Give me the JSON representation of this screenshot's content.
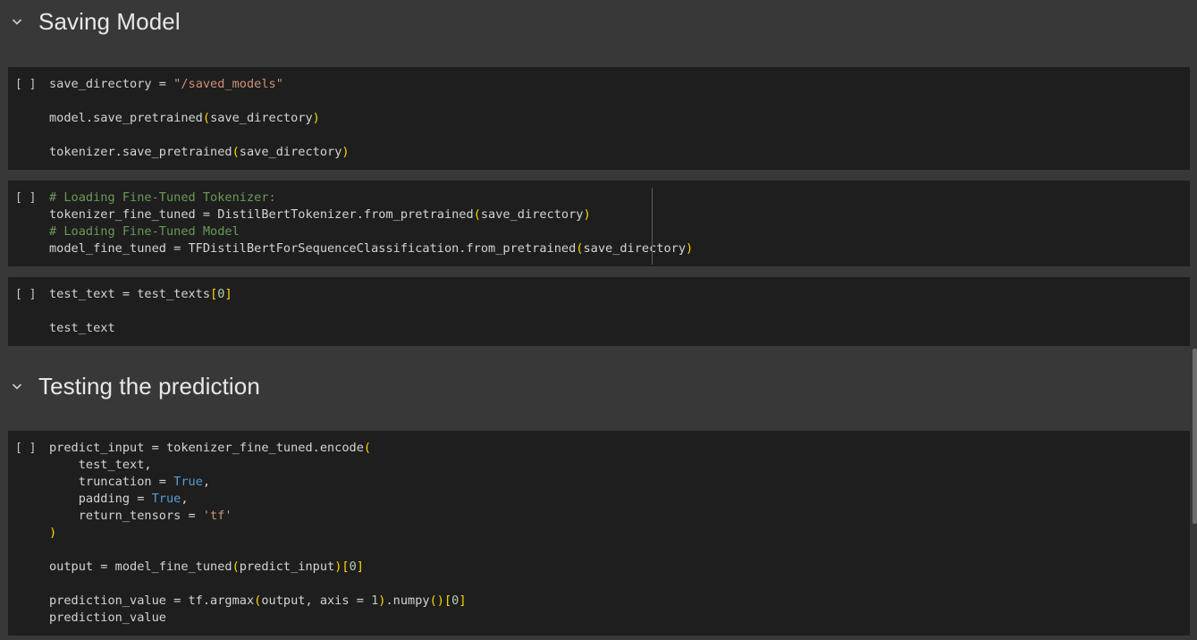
{
  "sections": [
    {
      "title": "Saving Model"
    },
    {
      "title": "Testing the prediction"
    }
  ],
  "run_label": "[ ]",
  "cells": [
    {
      "lines": [
        [
          {
            "t": "save_directory = ",
            "c": ""
          },
          {
            "t": "\"/saved_models\"",
            "c": "str"
          }
        ],
        [],
        [
          {
            "t": "model.save_pretrained",
            "c": ""
          },
          {
            "t": "(",
            "c": "par"
          },
          {
            "t": "save_directory",
            "c": ""
          },
          {
            "t": ")",
            "c": "par"
          }
        ],
        [],
        [
          {
            "t": "tokenizer.save_pretrained",
            "c": ""
          },
          {
            "t": "(",
            "c": "par"
          },
          {
            "t": "save_directory",
            "c": ""
          },
          {
            "t": ")",
            "c": "par"
          }
        ]
      ]
    },
    {
      "lines": [
        [
          {
            "t": "# Loading Fine-Tuned Tokenizer:",
            "c": "com"
          }
        ],
        [
          {
            "t": "tokenizer_fine_tuned = DistilBertTokenizer.from_pretrained",
            "c": ""
          },
          {
            "t": "(",
            "c": "par"
          },
          {
            "t": "save_directory",
            "c": ""
          },
          {
            "t": ")",
            "c": "par"
          }
        ],
        [
          {
            "t": "# Loading Fine-Tuned Model",
            "c": "com"
          }
        ],
        [
          {
            "t": "model_fine_tuned = TFDistilBertForSequenceClassification.from_pretrained",
            "c": ""
          },
          {
            "t": "(",
            "c": "par"
          },
          {
            "t": "save_directory",
            "c": ""
          },
          {
            "t": ")",
            "c": "par"
          }
        ]
      ]
    },
    {
      "lines": [
        [
          {
            "t": "test_text = test_texts",
            "c": ""
          },
          {
            "t": "[",
            "c": "br"
          },
          {
            "t": "0",
            "c": "num"
          },
          {
            "t": "]",
            "c": "br"
          }
        ],
        [],
        [
          {
            "t": "test_text",
            "c": ""
          }
        ]
      ]
    },
    {
      "lines": [
        [
          {
            "t": "predict_input = tokenizer_fine_tuned.encode",
            "c": ""
          },
          {
            "t": "(",
            "c": "par"
          }
        ],
        [
          {
            "t": "    test_text,",
            "c": ""
          }
        ],
        [
          {
            "t": "    truncation = ",
            "c": ""
          },
          {
            "t": "True",
            "c": "kw"
          },
          {
            "t": ",",
            "c": ""
          }
        ],
        [
          {
            "t": "    padding = ",
            "c": ""
          },
          {
            "t": "True",
            "c": "kw"
          },
          {
            "t": ",",
            "c": ""
          }
        ],
        [
          {
            "t": "    return_tensors = ",
            "c": ""
          },
          {
            "t": "'tf'",
            "c": "str"
          }
        ],
        [
          {
            "t": ")",
            "c": "par"
          }
        ],
        [],
        [
          {
            "t": "output = model_fine_tuned",
            "c": ""
          },
          {
            "t": "(",
            "c": "par"
          },
          {
            "t": "predict_input",
            "c": ""
          },
          {
            "t": ")",
            "c": "par"
          },
          {
            "t": "[",
            "c": "br"
          },
          {
            "t": "0",
            "c": "num"
          },
          {
            "t": "]",
            "c": "br"
          }
        ],
        [],
        [
          {
            "t": "prediction_value = tf.argmax",
            "c": ""
          },
          {
            "t": "(",
            "c": "par"
          },
          {
            "t": "output, axis = ",
            "c": ""
          },
          {
            "t": "1",
            "c": "num"
          },
          {
            "t": ")",
            "c": "par"
          },
          {
            "t": ".numpy",
            "c": ""
          },
          {
            "t": "()",
            "c": "par"
          },
          {
            "t": "[",
            "c": "br"
          },
          {
            "t": "0",
            "c": "num"
          },
          {
            "t": "]",
            "c": "br"
          }
        ],
        [
          {
            "t": "prediction_value",
            "c": ""
          }
        ]
      ]
    }
  ]
}
